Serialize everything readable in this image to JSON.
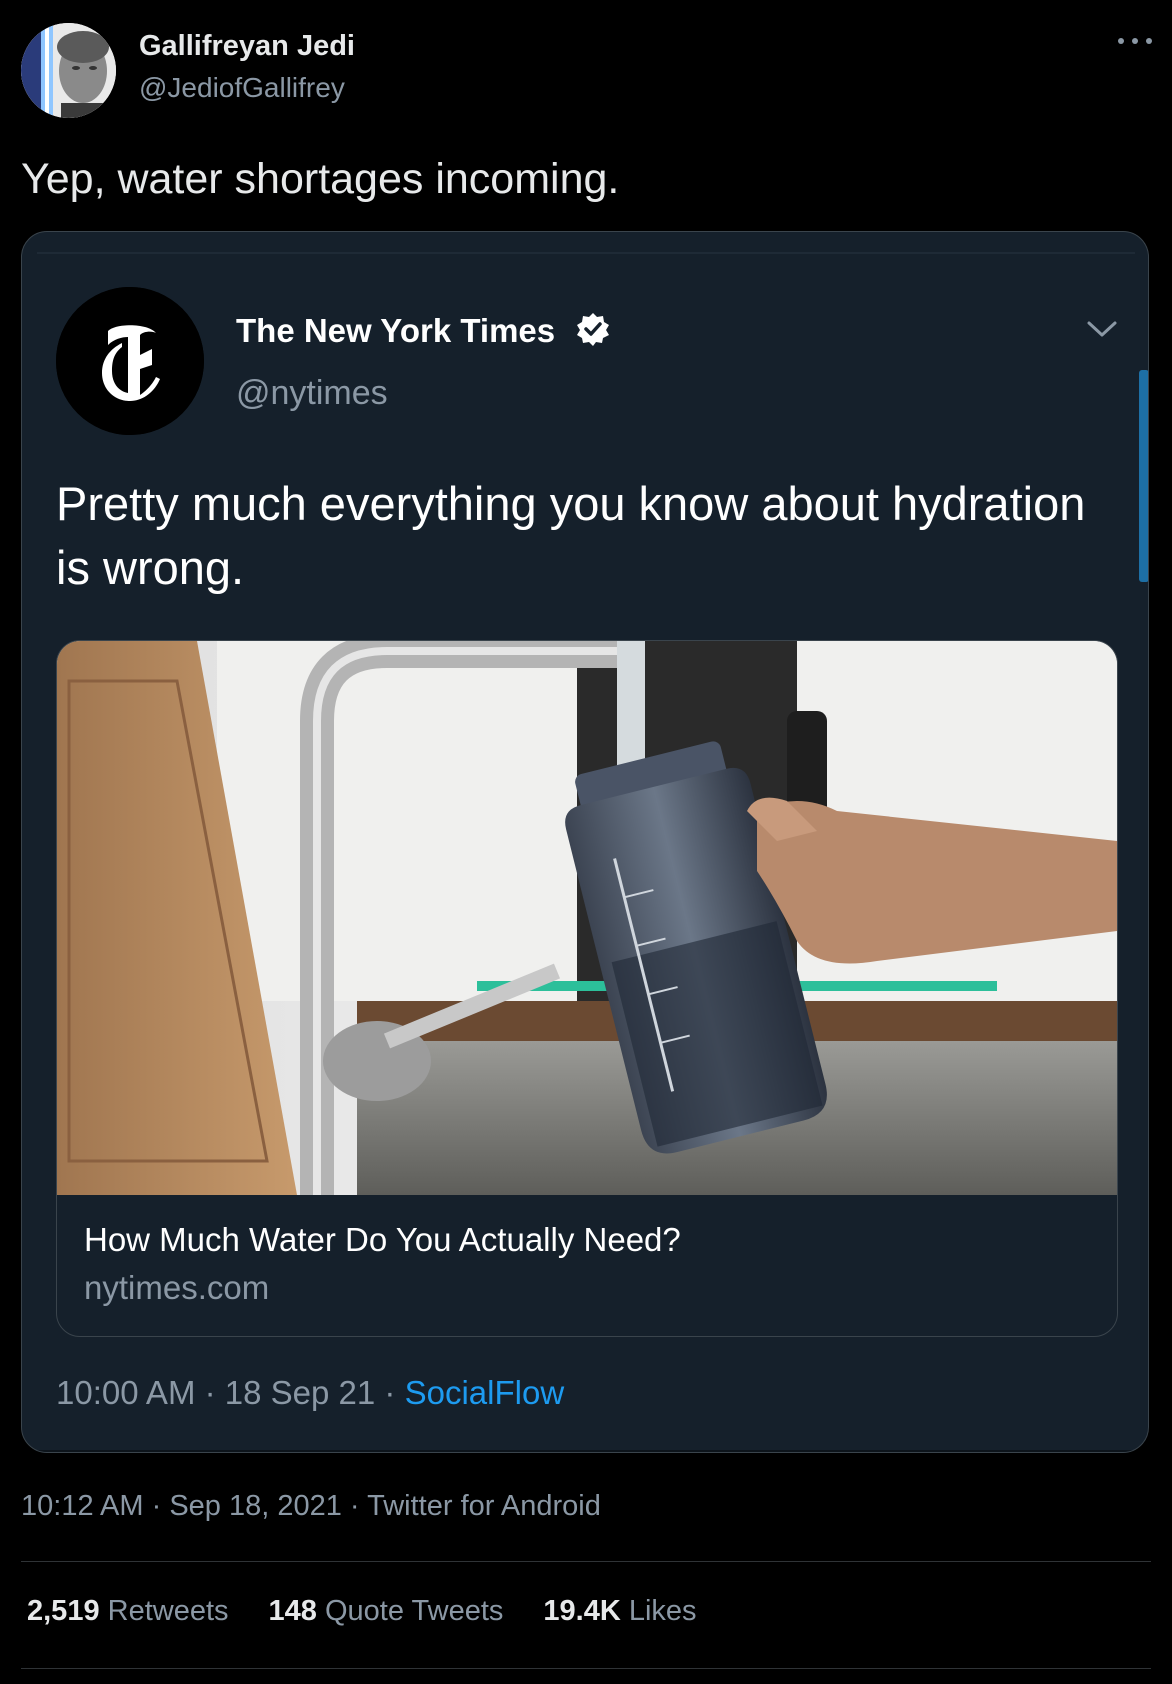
{
  "tweet": {
    "author": {
      "display_name": "Gallifreyan Jedi",
      "handle": "@JediofGallifrey"
    },
    "text": "Yep, water shortages incoming.",
    "time": "10:12 AM",
    "date": "Sep 18, 2021",
    "source": "Twitter for Android",
    "stats": {
      "retweets_count": "2,519",
      "retweets_label": "Retweets",
      "quotes_count": "148",
      "quotes_label": "Quote Tweets",
      "likes_count": "19.4K",
      "likes_label": "Likes"
    }
  },
  "quoted": {
    "author": {
      "display_name": "The New York Times",
      "handle": "@nytimes",
      "verified": true
    },
    "text": "Pretty much everything you know about hydration is wrong.",
    "link_card": {
      "title": "How Much Water Do You Actually Need?",
      "domain": "nytimes.com"
    },
    "time": "10:00 AM",
    "date": "18 Sep 21",
    "source": "SocialFlow"
  },
  "icons": {
    "more": "more-horizontal-icon",
    "verified": "verified-badge-icon",
    "chevron": "chevron-down-icon"
  },
  "colors": {
    "background": "#000000",
    "card_background": "#15202b",
    "accent_link": "#1d9bf0",
    "text_secondary": "#8b98a5"
  }
}
